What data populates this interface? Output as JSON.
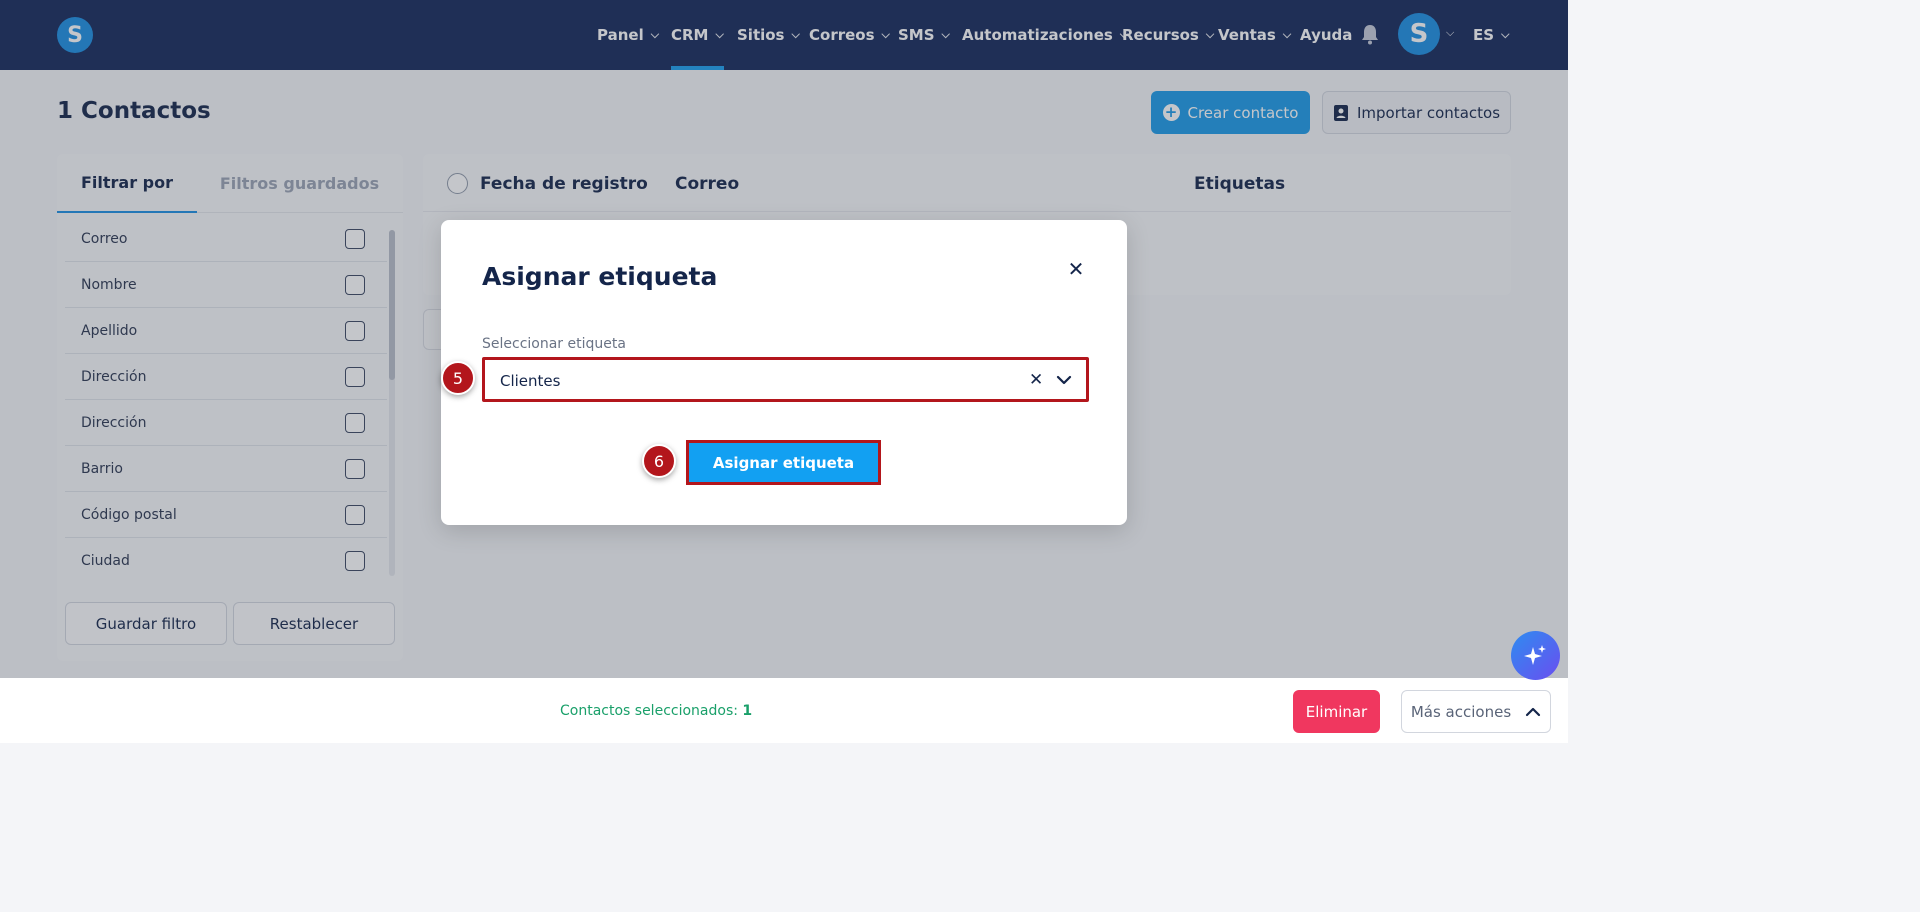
{
  "logo": {
    "letter": "S"
  },
  "nav": {
    "items": [
      {
        "label": "Panel",
        "chevron": true
      },
      {
        "label": "CRM",
        "chevron": true,
        "active": true
      },
      {
        "label": "Sitios",
        "chevron": true
      },
      {
        "label": "Correos",
        "chevron": true
      },
      {
        "label": "SMS",
        "chevron": true
      },
      {
        "label": "Automatizaciones",
        "chevron": true
      },
      {
        "label": "Recursos",
        "chevron": true
      },
      {
        "label": "Ventas",
        "chevron": true
      },
      {
        "label": "Ayuda",
        "chevron": false
      }
    ],
    "avatar_letter": "S",
    "language": "ES"
  },
  "page": {
    "title": "1 Contactos",
    "create_button": "Crear contacto",
    "import_button": "Importar contactos"
  },
  "filters": {
    "tab_filter": "Filtrar por",
    "tab_saved": "Filtros guardados",
    "items": [
      "Correo",
      "Nombre",
      "Apellido",
      "Dirección",
      "Dirección",
      "Barrio",
      "Código postal",
      "Ciudad"
    ],
    "save_button": "Guardar filtro",
    "reset_button": "Restablecer"
  },
  "table": {
    "columns": [
      "Fecha de registro",
      "Correo",
      "Etiquetas"
    ]
  },
  "bottom": {
    "selected_label": "Contactos seleccionados:",
    "selected_count": "1",
    "delete_button": "Eliminar",
    "more_button": "Más acciones"
  },
  "modal": {
    "title": "Asignar etiqueta",
    "field_label": "Seleccionar etiqueta",
    "selected_value": "Clientes",
    "clear_symbol": "✕",
    "assign_button": "Asignar etiqueta",
    "step_select": "5",
    "step_assign": "6"
  },
  "colors": {
    "nav_bg": "#14285a",
    "accent": "#1a9ae8",
    "highlight": "#b3161c",
    "danger": "#f0375f",
    "success": "#1aa06a"
  }
}
